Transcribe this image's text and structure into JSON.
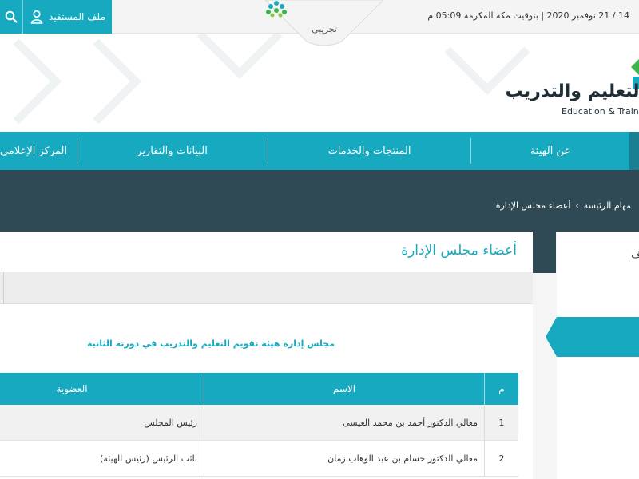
{
  "topbar": {
    "datetime": "14 / 21 نوفمبر 2020 | بتوقيت مكة المكرمة 05:09 م",
    "profile_label": "ملف المستفيد",
    "badge_label": "تجريبي"
  },
  "brand": {
    "name_ar": "التعليم والتدريب",
    "name_en": "Education & Training"
  },
  "nav": {
    "items": [
      "عن الهيئة",
      "المنتجات والخدمات",
      "البيانات والتقارير",
      "المركز الإعلامي"
    ]
  },
  "breadcrumb": {
    "items": [
      "مهام الرئيسة",
      "أعضاء مجلس الإدارة"
    ],
    "separator": "›"
  },
  "main": {
    "title": "أعضاء مجلس الإدارة",
    "subtitle": "مجلس إدارة هيئة تقويم التعليم والتدريب في دورته الثانية"
  },
  "table": {
    "headers": [
      "م",
      "الاسم",
      "العضوية"
    ],
    "rows": [
      [
        "1",
        "معالي الدكتور أحمد بن محمد العيسى",
        "رئيس المجلس"
      ],
      [
        "2",
        "معالي الدكتور حسام بن عبد الوهاب زمان",
        "نائب الرئيس (رئيس الهيئة)"
      ]
    ]
  },
  "side": {
    "text": "اف"
  },
  "colors": {
    "accent": "#16a9bf",
    "dark_band": "#2f4a55",
    "topbar_bg": "#f4f4f4"
  }
}
